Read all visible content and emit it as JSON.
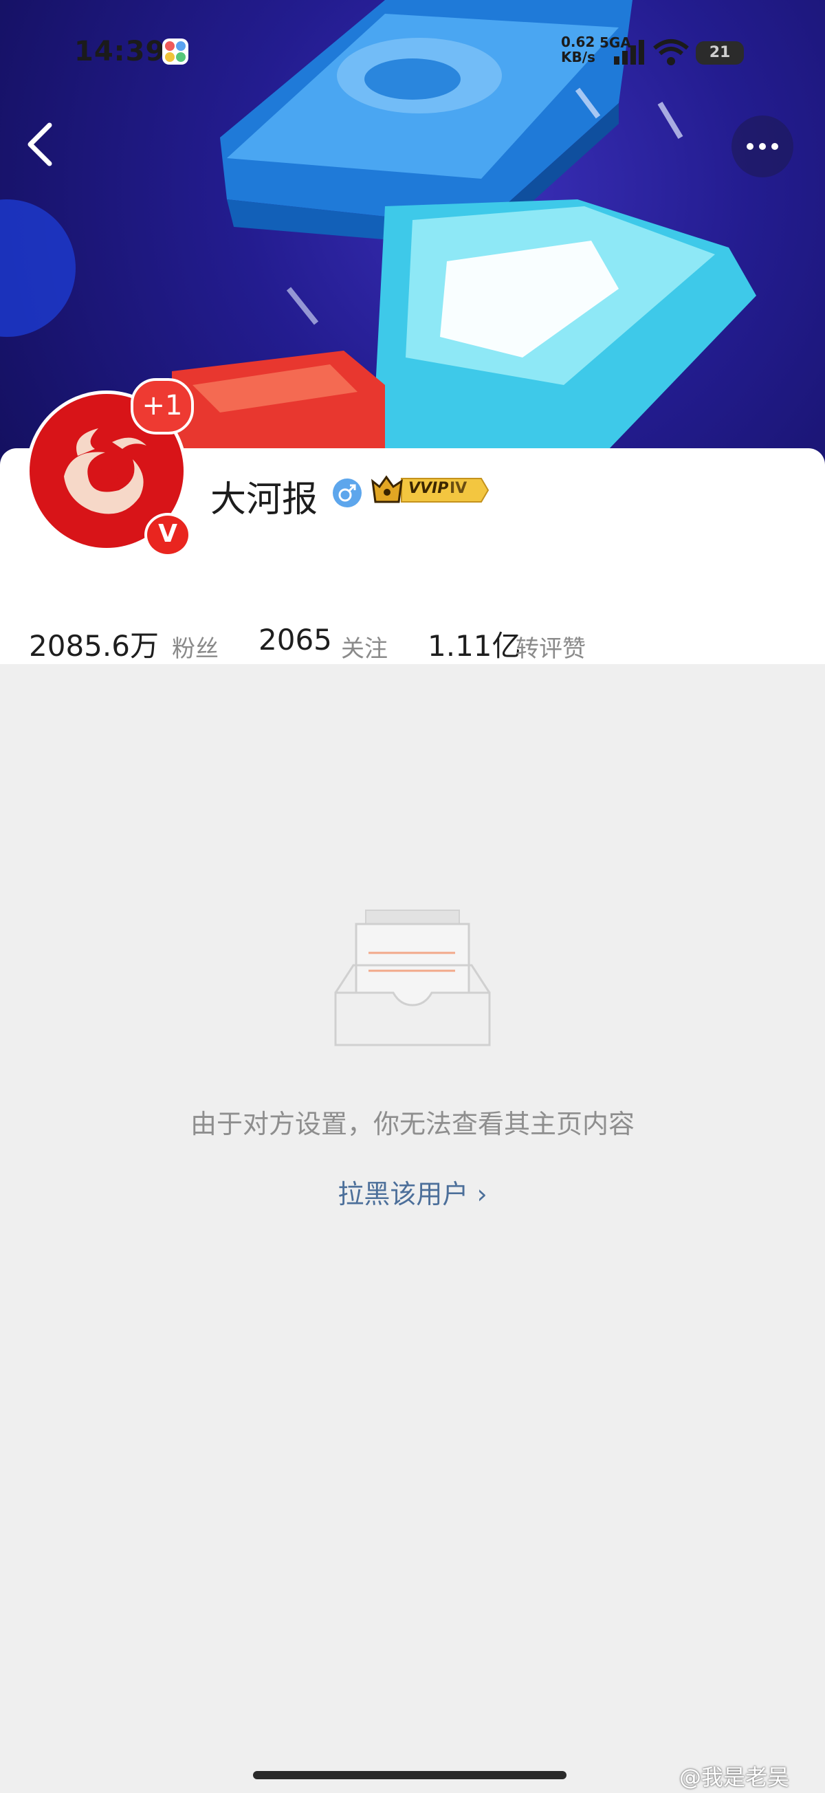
{
  "status_bar": {
    "time": "14:39",
    "net_speed_value": "0.62",
    "net_speed_unit": "KB/s",
    "network_type": "5GA",
    "battery": "21"
  },
  "profile": {
    "name": "大河报",
    "badge_count": "+1",
    "verified_mark": "V",
    "vip_label": "VVIP",
    "vip_level": "IV"
  },
  "stats": {
    "fans_value": "2085.6万",
    "fans_label": "粉丝",
    "following_value": "2065",
    "following_label": "关注",
    "interactions_value": "1.11亿",
    "interactions_label": "转评赞"
  },
  "empty_state": {
    "message": "由于对方设置，你无法查看其主页内容",
    "action": "拉黑该用户 ›"
  },
  "watermark": "@我是老吴",
  "colors": {
    "banner_bg": "#231c8f",
    "avatar_red": "#d81418",
    "link_blue": "#4c6f9a",
    "page_bg": "#efefef"
  }
}
